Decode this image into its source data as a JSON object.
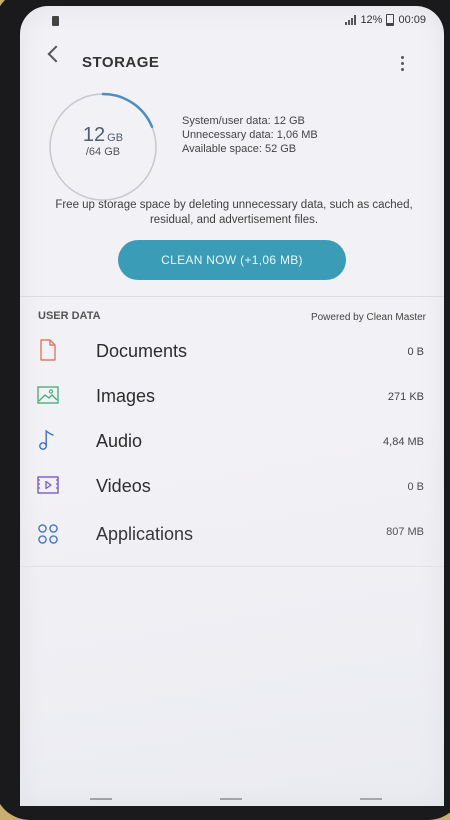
{
  "status_bar": {
    "battery_text": "12%",
    "time": "00:09"
  },
  "app_bar": {
    "title": "STORAGE"
  },
  "summary": {
    "used_value": "12",
    "used_unit": "GB",
    "total": "/64 GB",
    "used_fraction": 0.1875,
    "system_data": "System/user data: 12 GB",
    "unnecessary_data": "Unnecessary data: 1,06 MB",
    "available_space": "Available space: 52 GB",
    "ring_color": "#4a8fc0"
  },
  "hint_text": "Free up storage space by deleting unnecessary data, such as cached, residual, and advertisement files.",
  "clean_button": {
    "label": "CLEAN NOW (+1,06 MB)",
    "color": "#3a9cb7"
  },
  "user_data": {
    "heading": "USER DATA",
    "powered_by": "Powered by Clean Master",
    "items": [
      {
        "label": "Documents",
        "size": "0 B",
        "icon": "document-icon",
        "color": "#e07a5f"
      },
      {
        "label": "Images",
        "size": "271 KB",
        "icon": "image-icon",
        "color": "#4caf7a"
      },
      {
        "label": "Audio",
        "size": "4,84 MB",
        "icon": "music-note-icon",
        "color": "#3b6fc9"
      },
      {
        "label": "Videos",
        "size": "0 B",
        "icon": "video-icon",
        "color": "#7a5cc9"
      },
      {
        "label": "Applications",
        "size": "807 MB",
        "icon": "apps-grid-icon",
        "color": "#3b6fc9"
      }
    ]
  }
}
